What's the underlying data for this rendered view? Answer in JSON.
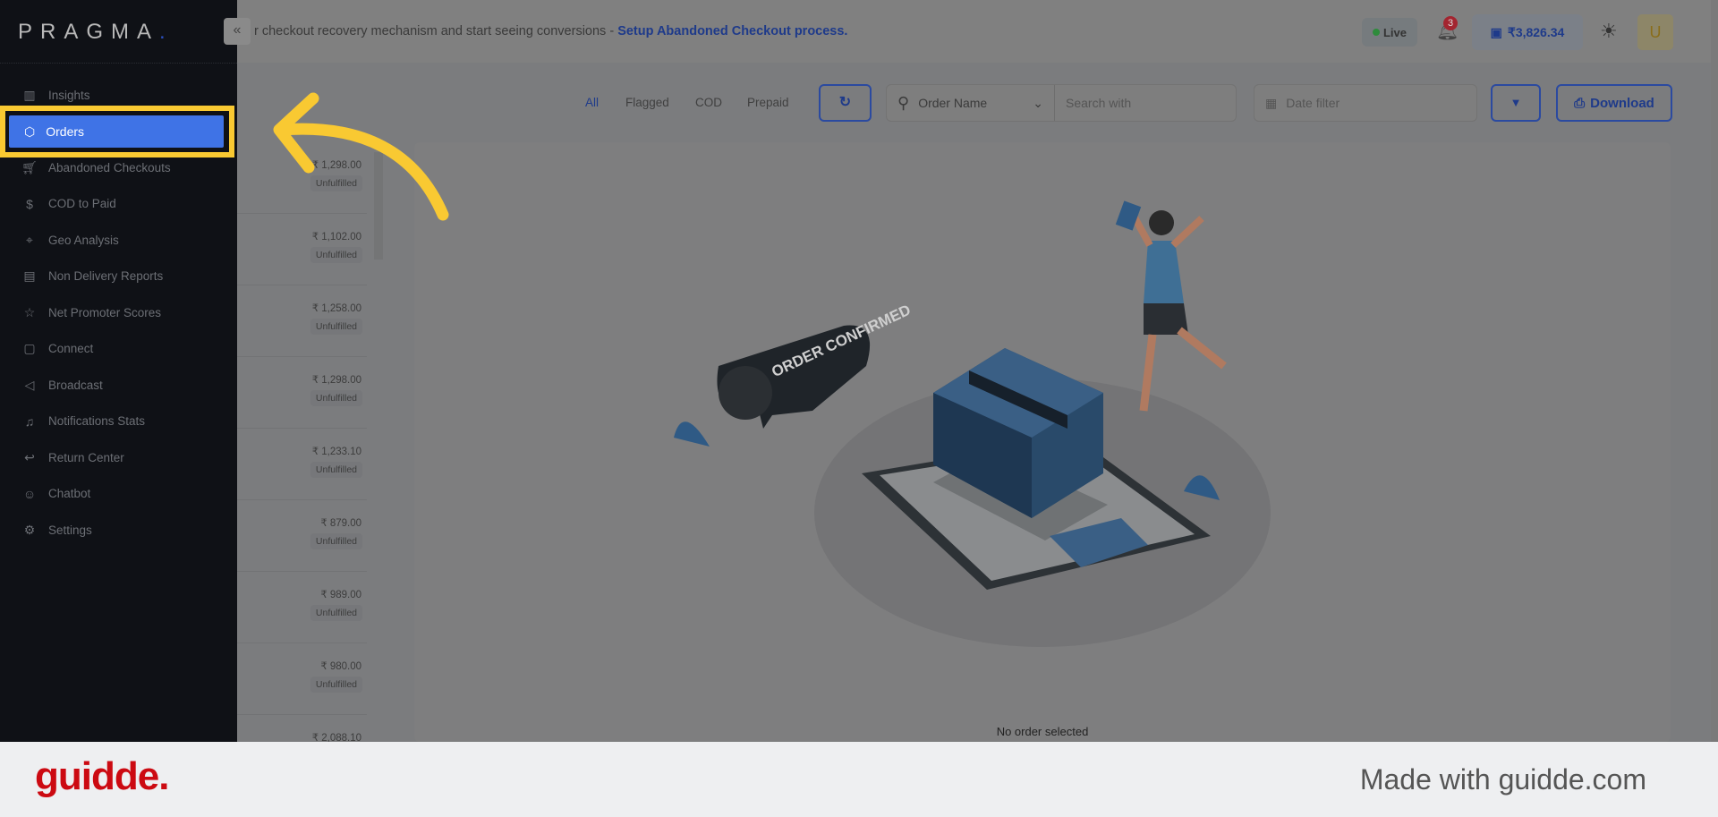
{
  "brand": {
    "name": "PRAGMA",
    "dot": "."
  },
  "sidebar": {
    "items": [
      {
        "label": "Insights",
        "icon": "bar-chart-icon"
      },
      {
        "label": "Orders",
        "icon": "box-icon",
        "active": true
      },
      {
        "label": "Abandoned Checkouts",
        "icon": "cart-icon"
      },
      {
        "label": "COD to Paid",
        "icon": "dollar-icon"
      },
      {
        "label": "Geo Analysis",
        "icon": "pin-icon"
      },
      {
        "label": "Non Delivery Reports",
        "icon": "clipboard-icon"
      },
      {
        "label": "Net Promoter Scores",
        "icon": "star-icon"
      },
      {
        "label": "Connect",
        "icon": "chat-icon"
      },
      {
        "label": "Broadcast",
        "icon": "megaphone-icon"
      },
      {
        "label": "Notifications Stats",
        "icon": "bell-icon"
      },
      {
        "label": "Return Center",
        "icon": "return-icon"
      },
      {
        "label": "Chatbot",
        "icon": "bot-icon"
      },
      {
        "label": "Settings",
        "icon": "gear-icon"
      }
    ]
  },
  "header": {
    "banner_text": "r checkout recovery mechanism and start seeing conversions - ",
    "banner_link": "Setup Abandoned Checkout process.",
    "live": "Live",
    "notifications": "3",
    "wallet": "₹3,826.34",
    "avatar": "U"
  },
  "toolbar": {
    "tabs": [
      "All",
      "Flagged",
      "COD",
      "Prepaid"
    ],
    "search_field": "Order Name",
    "search_placeholder": "Search with",
    "date_placeholder": "Date filter",
    "download": "Download"
  },
  "orders": [
    {
      "amount": "₹ 1,298.00",
      "status": "Unfulfilled"
    },
    {
      "amount": "₹ 1,102.00",
      "status": "Unfulfilled"
    },
    {
      "amount": "₹ 1,258.00",
      "status": "Unfulfilled"
    },
    {
      "amount": "₹ 1,298.00",
      "status": "Unfulfilled"
    },
    {
      "amount": "₹ 1,233.10",
      "status": "Unfulfilled"
    },
    {
      "amount": "₹ 879.00",
      "status": "Unfulfilled"
    },
    {
      "amount": "₹ 989.00",
      "status": "Unfulfilled"
    },
    {
      "amount": "₹ 980.00",
      "status": "Unfulfilled"
    },
    {
      "amount": "₹ 2,088.10",
      "status": ""
    }
  ],
  "detail": {
    "illustration_text": "ORDER CONFIRMED",
    "empty": "No order selected"
  },
  "footer": {
    "logo": "guidde.",
    "made_with": "Made with guidde.com"
  },
  "colors": {
    "accent": "#3f73e6",
    "highlight": "#f9c932",
    "guidde_red": "#cc0a12"
  }
}
